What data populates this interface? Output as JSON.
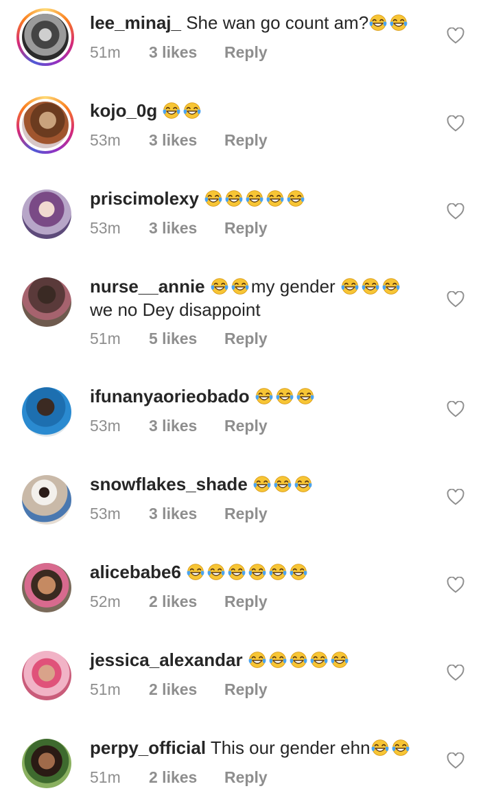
{
  "colors": {
    "username": "#262626",
    "meta_text": "#8e8e8e",
    "heart_outline": "#8e8e8e",
    "emoji_face": "#f7c535",
    "emoji_tear": "#4aa3f0"
  },
  "icons": {
    "emoji": "face-with-tears-of-joy",
    "like": "heart-outline-icon"
  },
  "comments": [
    {
      "username": "lee_minaj_",
      "text": "She wan go count am?",
      "emoji_count": 2,
      "time": "51m",
      "likes": "3 likes",
      "reply": "Reply",
      "story_ring": true
    },
    {
      "username": "kojo_0g",
      "text": "",
      "emoji_count": 2,
      "time": "53m",
      "likes": "3 likes",
      "reply": "Reply",
      "story_ring": true
    },
    {
      "username": "priscimolexy",
      "text": "",
      "emoji_count": 5,
      "time": "53m",
      "likes": "3 likes",
      "reply": "Reply",
      "story_ring": false
    },
    {
      "username": "nurse__annie",
      "text": "my gender",
      "text2": "we no Dey disappoint",
      "emoji_count": 2,
      "emoji_count_after": 3,
      "time": "51m",
      "likes": "5 likes",
      "reply": "Reply",
      "story_ring": false
    },
    {
      "username": "ifunanyaorieobado",
      "text": "",
      "emoji_count": 3,
      "time": "53m",
      "likes": "3 likes",
      "reply": "Reply",
      "story_ring": false
    },
    {
      "username": "snowflakes_shade",
      "text": "",
      "emoji_count": 3,
      "time": "53m",
      "likes": "3 likes",
      "reply": "Reply",
      "story_ring": false
    },
    {
      "username": "alicebabe6",
      "text": "",
      "emoji_count": 6,
      "time": "52m",
      "likes": "2 likes",
      "reply": "Reply",
      "story_ring": false
    },
    {
      "username": "jessica_alexandar",
      "text": "",
      "emoji_count": 5,
      "time": "51m",
      "likes": "2 likes",
      "reply": "Reply",
      "story_ring": false
    },
    {
      "username": "perpy_official",
      "text": "This our gender ehn",
      "emoji_count": 2,
      "time": "51m",
      "likes": "2 likes",
      "reply": "Reply",
      "story_ring": false
    }
  ]
}
